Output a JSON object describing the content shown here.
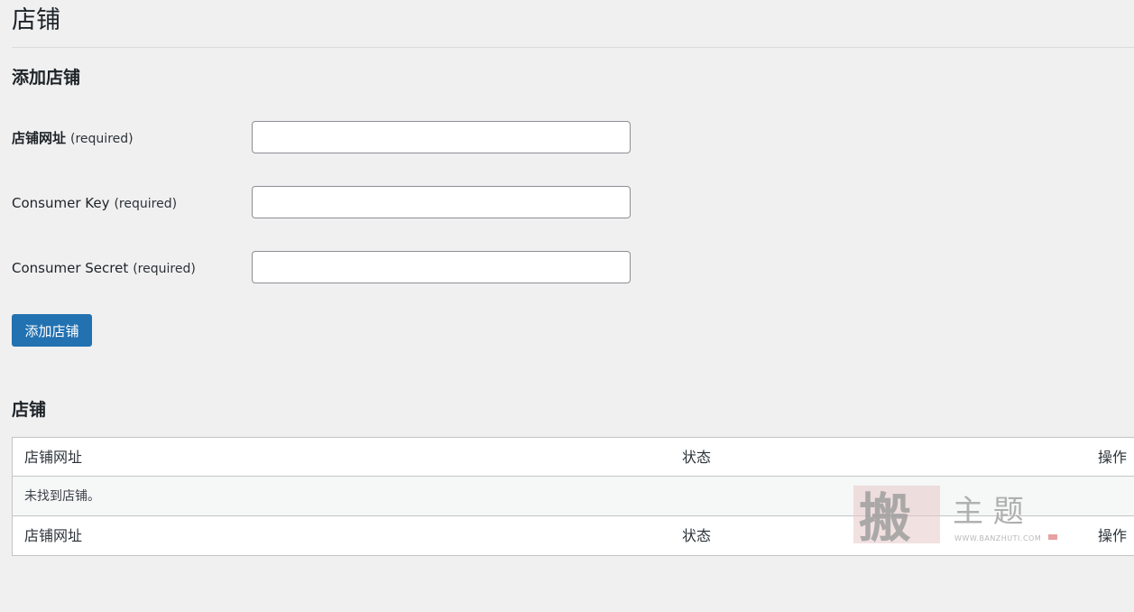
{
  "page": {
    "title": "店铺"
  },
  "add_section": {
    "title": "添加店铺",
    "fields": [
      {
        "label": "店铺网址",
        "required_text": "(required)",
        "value": "",
        "placeholder": ""
      },
      {
        "label": "Consumer Key",
        "required_text": "(required)",
        "value": "",
        "placeholder": ""
      },
      {
        "label": "Consumer Secret",
        "required_text": "(required)",
        "value": "",
        "placeholder": ""
      }
    ],
    "submit_label": "添加店铺"
  },
  "stores_section": {
    "title": "店铺",
    "columns": [
      "店铺网址",
      "状态",
      "操作"
    ],
    "empty_message": "未找到店铺。"
  },
  "watermark": {
    "glyph": "搬",
    "text": "主 题",
    "url": "WWW.BANZHUTI.COM"
  },
  "colors": {
    "primary_button": "#2271b1",
    "background": "#f0f0f1",
    "border": "#c3c4c7"
  }
}
